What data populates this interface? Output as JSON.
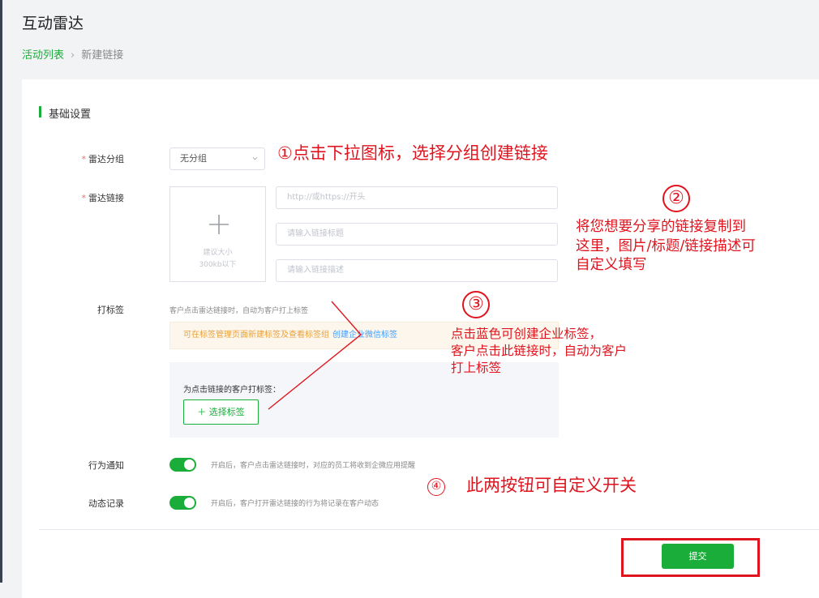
{
  "header": {
    "title": "互动雷达",
    "breadcrumb": {
      "link": "活动列表",
      "current": "新建链接"
    }
  },
  "section": {
    "title": "基础设置"
  },
  "form": {
    "group": {
      "label": "雷达分组",
      "required_mark": "*",
      "value": "无分组"
    },
    "link": {
      "label": "雷达链接",
      "required_mark": "*",
      "upload_hint_line1": "建议大小",
      "upload_hint_line2": "300kb以下",
      "url_placeholder": "http://或https://开头",
      "title_placeholder": "请输入链接标题",
      "desc_placeholder": "请输入链接描述"
    },
    "tagging": {
      "label": "打标签",
      "tip": "客户点击雷达链接时，自动为客户打上标签",
      "notice": "可在标签管理页面新建标签及查看标签组",
      "notice_link": "创建企业微信标签",
      "panel_label": "为点击链接的客户打标签：",
      "select_button": "＋ 选择标签"
    },
    "behavior_notice": {
      "label": "行为通知",
      "enabled": true,
      "desc": "开启后，客户点击雷达链接时，对应的员工将收到企微应用提醒"
    },
    "activity_log": {
      "label": "动态记录",
      "enabled": true,
      "desc": "开启后，客户打开雷达链接的行为将记录在客户动态"
    },
    "submit_label": "提交"
  },
  "annotations": {
    "a1": "①点击下拉图标，选择分组创建链接",
    "a2_num": "②",
    "a2_lines": [
      "将您想要分享的链接复制到",
      "这里，图片/标题/链接描述可",
      "自定义填写"
    ],
    "a3_num": "③",
    "a3_lines": [
      "点击蓝色可创建企业标签，",
      "客户点击此链接时，自动为客户",
      "打上标签"
    ],
    "a4_num": "④",
    "a4_text": "此两按钮可自定义开关"
  },
  "colors": {
    "accent": "#1aad3a",
    "annotation": "#e0141e",
    "link": "#409eff",
    "warning": "#e6a23c"
  }
}
